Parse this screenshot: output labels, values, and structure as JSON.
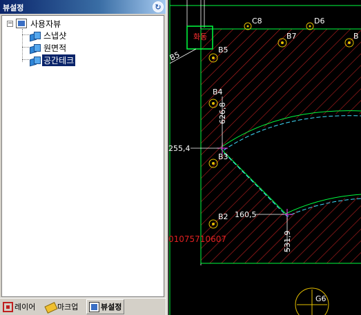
{
  "panel": {
    "title": "뷰설정",
    "title_icon": "refresh-icon",
    "tree": {
      "root": {
        "label": "사용자뷰",
        "icon": "view-root-icon",
        "expander": "⊟"
      },
      "children": [
        {
          "label": "스냅샷",
          "icon": "view-icon",
          "selected": false
        },
        {
          "label": "원면적",
          "icon": "view-icon",
          "selected": false
        },
        {
          "label": "공간테크",
          "icon": "view-icon",
          "selected": true
        }
      ]
    }
  },
  "tabs": [
    {
      "label": "레이어",
      "icon": "layer-icon",
      "active": false
    },
    {
      "label": "마크업",
      "icon": "markup-icon",
      "active": false
    },
    {
      "label": "뷰설정",
      "icon": "view-settings-icon",
      "active": true
    }
  ],
  "cad": {
    "room_label": "화동",
    "wall_tag": "B5",
    "points": [
      "C8",
      "D6",
      "B7",
      "B",
      "B5",
      "B4",
      "B3",
      "B2",
      "G6"
    ],
    "dimensions": [
      "626,8",
      "255,4",
      "160,5",
      "531,9"
    ],
    "phone_text": "01075710607",
    "colors": {
      "background": "#000000",
      "hatch": "#c02020",
      "walls": "#00ff40",
      "centerline": "#40e0ff",
      "points": "#e6c000",
      "dimension": "#ffffff",
      "marker": "#ff40ff",
      "room_box": "#00ff40",
      "room_text": "#ff3030"
    }
  }
}
